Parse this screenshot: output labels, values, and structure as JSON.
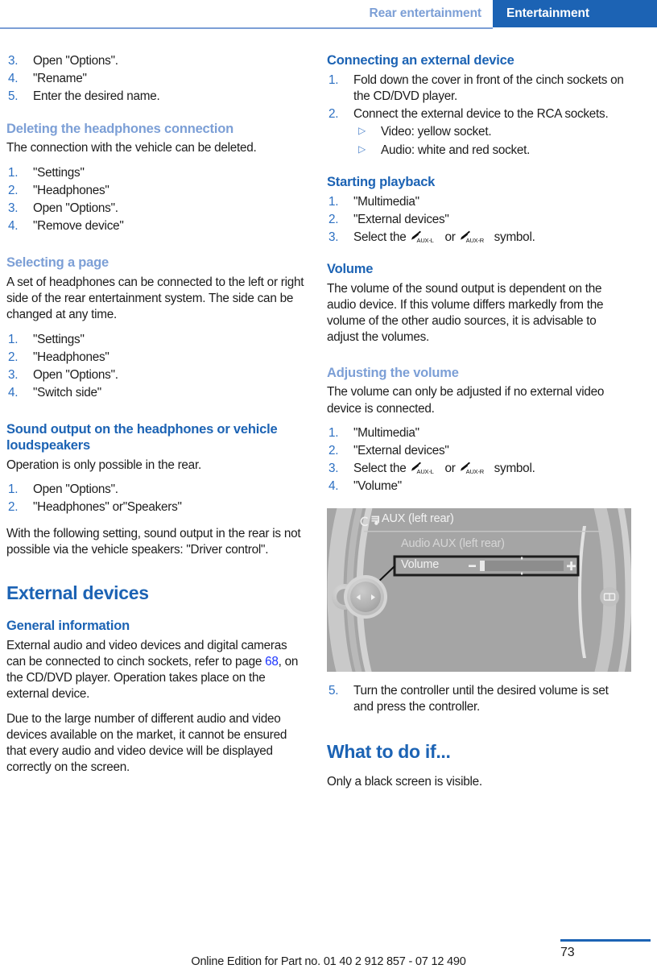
{
  "header": {
    "chapter": "Rear entertainment",
    "section": "Entertainment"
  },
  "left_column": {
    "steps_continued": [
      {
        "num": "3.",
        "text": "Open \"Options\"."
      },
      {
        "num": "4.",
        "text": "\"Rename\""
      },
      {
        "num": "5.",
        "text": "Enter the desired name."
      }
    ],
    "deleting": {
      "heading": "Deleting the headphones connection",
      "intro": "The connection with the vehicle can be deleted.",
      "steps": [
        {
          "num": "1.",
          "text": "\"Settings\""
        },
        {
          "num": "2.",
          "text": "\"Headphones\""
        },
        {
          "num": "3.",
          "text": "Open \"Options\"."
        },
        {
          "num": "4.",
          "text": "\"Remove device\""
        }
      ]
    },
    "selecting_page": {
      "heading": "Selecting a page",
      "intro": "A set of headphones can be connected to the left or right side of the rear entertainment system. The side can be changed at any time.",
      "steps": [
        {
          "num": "1.",
          "text": "\"Settings\""
        },
        {
          "num": "2.",
          "text": "\"Headphones\""
        },
        {
          "num": "3.",
          "text": "Open \"Options\"."
        },
        {
          "num": "4.",
          "text": "\"Switch side\""
        }
      ]
    },
    "sound_output": {
      "heading": "Sound output on the headphones or vehicle loudspeakers",
      "intro": "Operation is only possible in the rear.",
      "steps": [
        {
          "num": "1.",
          "text": "Open \"Options\"."
        },
        {
          "num": "2.",
          "text": "\"Headphones\" or\"Speakers\""
        }
      ],
      "note": "With the following setting, sound output in the rear is not possible via the vehicle speakers: \"Driver control\"."
    },
    "external_devices": {
      "heading": "External devices",
      "general_heading": "General information",
      "para1_a": "External audio and video devices and digital cameras can be connected to cinch sockets, refer to page ",
      "para1_link": "68",
      "para1_b": ", on the CD/DVD player. Operation takes place on the external device.",
      "para2": "Due to the large number of different audio and video devices available on the market, it cannot be ensured that every audio and video device will be displayed correctly on the screen."
    }
  },
  "right_column": {
    "connecting": {
      "heading": "Connecting an external device",
      "steps": [
        {
          "num": "1.",
          "text": "Fold down the cover in front of the cinch sockets on the CD/DVD player."
        },
        {
          "num": "2.",
          "text": "Connect the external device to the RCA sockets."
        }
      ],
      "substeps": [
        {
          "bullet": "▷",
          "text": "Video: yellow socket."
        },
        {
          "bullet": "▷",
          "text": "Audio: white and red socket."
        }
      ]
    },
    "starting_playback": {
      "heading": "Starting playback",
      "steps": [
        {
          "num": "1.",
          "text": "\"Multimedia\""
        },
        {
          "num": "2.",
          "text": "\"External devices\""
        }
      ],
      "step3_pre": "Select the",
      "step3_sym1": "AUX-L",
      "step3_mid": "or",
      "step3_sym2": "AUX-R",
      "step3_post": "symbol.",
      "step3_num": "3."
    },
    "volume": {
      "heading": "Volume",
      "text": "The volume of the sound output is dependent on the audio device. If this volume differs markedly from the volume of the other audio sources, it is advisable to adjust the volumes."
    },
    "adjusting": {
      "heading": "Adjusting the volume",
      "intro": "The volume can only be adjusted if no external video device is connected.",
      "steps": [
        {
          "num": "1.",
          "text": "\"Multimedia\""
        },
        {
          "num": "2.",
          "text": "\"External devices\""
        }
      ],
      "step3_num": "3.",
      "step3_pre": "Select the",
      "step3_sym1": "AUX-L",
      "step3_mid": "or",
      "step3_sym2": "AUX-R",
      "step3_post": "symbol.",
      "step4": {
        "num": "4.",
        "text": "\"Volume\""
      },
      "step5": {
        "num": "5.",
        "text": "Turn the controller until the desired volume is set and press the controller."
      }
    },
    "figure": {
      "title": "AUX (left rear)",
      "subtitle": "Audio AUX (left rear)",
      "row_label": "Volume",
      "minus": "−",
      "plus": "+"
    },
    "what_to_do": {
      "heading": "What to do if...",
      "text": "Only a black screen is visible."
    }
  },
  "footer": {
    "edition": "Online Edition for Part no. 01 40 2 912 857 - 07 12 490",
    "page_number": "73"
  },
  "colors": {
    "brand_blue": "#1c63b4",
    "light_blue": "#7c9fd6",
    "link_blue": "#1a33ff",
    "number_blue": "#2b6fc2",
    "body_text": "#1c1c1c"
  }
}
